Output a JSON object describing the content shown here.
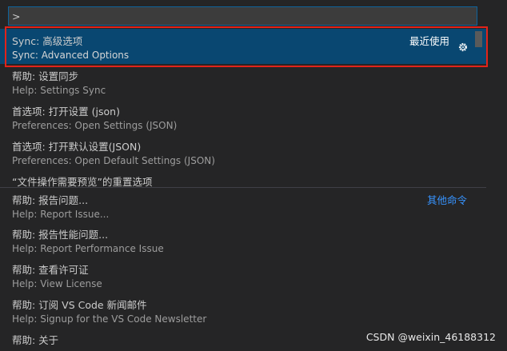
{
  "input": {
    "value": ">"
  },
  "items": [
    {
      "label": "Sync: 高级选项",
      "detail": "Sync: Advanced Options",
      "badge": "最近使用",
      "gear_icon": "gear-icon"
    },
    {
      "label": "帮助: 设置同步",
      "detail": "Help: Settings Sync"
    },
    {
      "label": "首选项: 打开设置 (json)",
      "detail": "Preferences: Open Settings (JSON)"
    },
    {
      "label": "首选项: 打开默认设置(JSON)",
      "detail": "Preferences: Open Default Settings (JSON)"
    },
    {
      "label": "“文件操作需要预览”的重置选项"
    },
    {
      "label": "帮助: 报告问题...",
      "detail": "Help: Report Issue...",
      "badge": "其他命令"
    },
    {
      "label": "帮助: 报告性能问题...",
      "detail": "Help: Report Performance Issue"
    },
    {
      "label": "帮助: 查看许可证",
      "detail": "Help: View License"
    },
    {
      "label": "帮助: 订阅 VS Code 新闻邮件",
      "detail": "Help: Signup for the VS Code Newsletter"
    },
    {
      "label": "帮助: 关于"
    }
  ],
  "watermark": "CSDN @weixin_46188312",
  "colors": {
    "selected_bg": "#094771",
    "highlight_border": "#e2231a",
    "link": "#3794ff"
  }
}
